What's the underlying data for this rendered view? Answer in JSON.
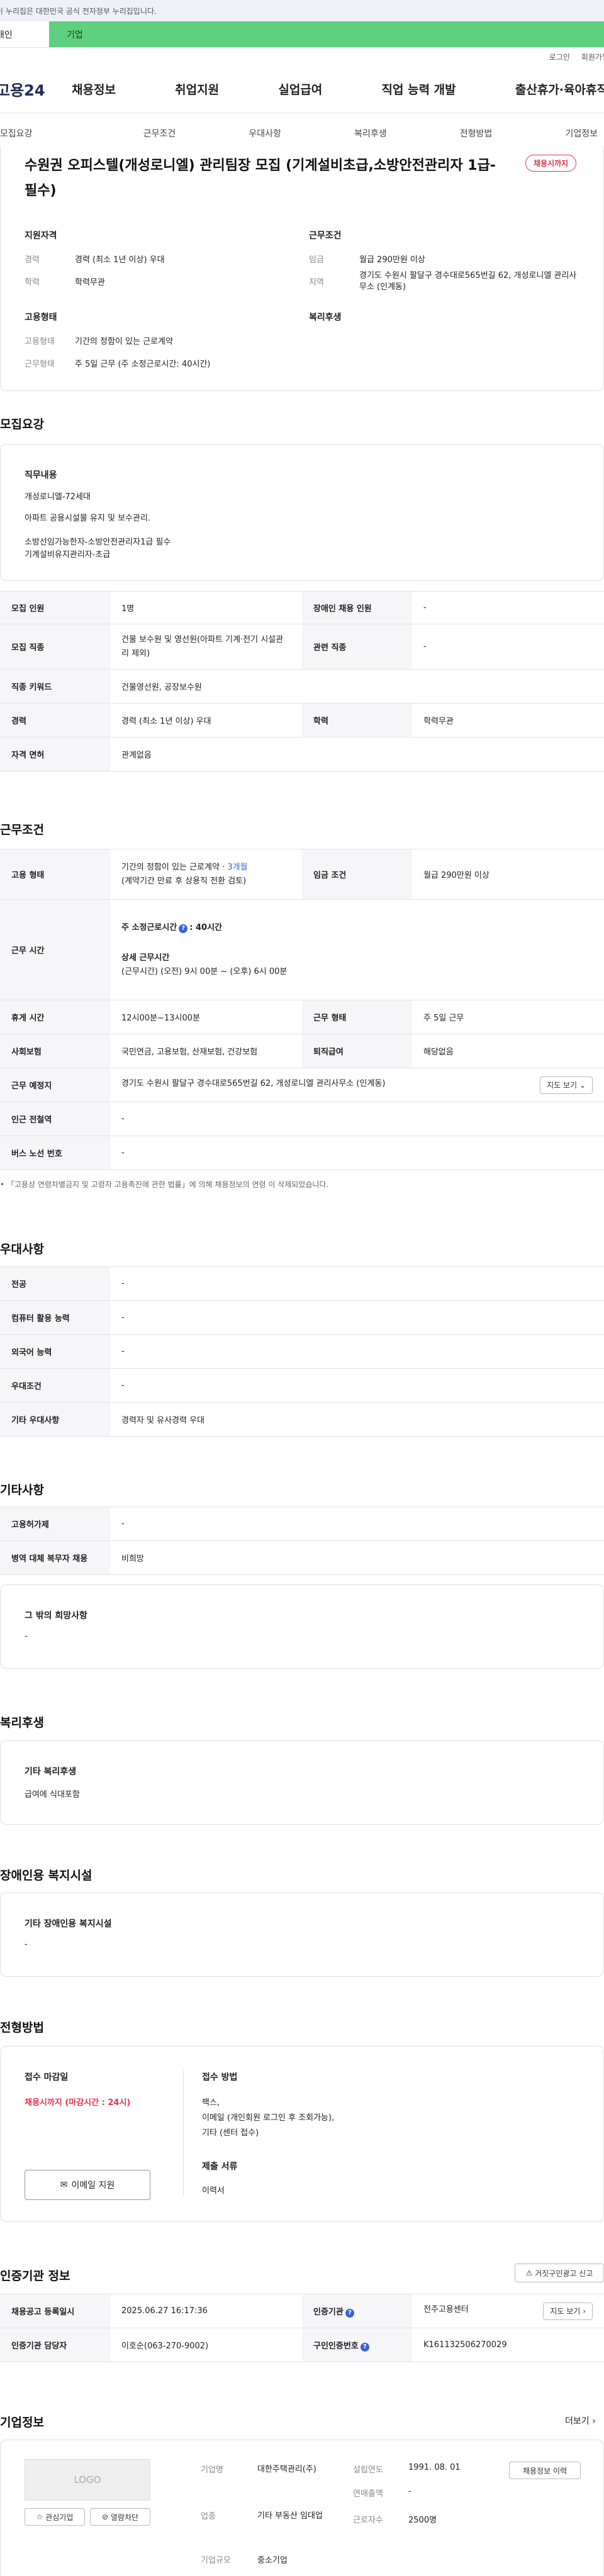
{
  "gov_notice": "이 누리집은 대한민국 공식 전자정부 누리집입니다.",
  "top_tabs": {
    "individual": "개인",
    "enterprise": "기업"
  },
  "util": {
    "login": "로그인",
    "join": "회원가입"
  },
  "logo": "고용24",
  "gnb": [
    "채용정보",
    "취업지원",
    "실업급여",
    "직업 능력 개발",
    "출산휴가·육아휴직"
  ],
  "subnav": [
    "모집요강",
    "근무조건",
    "우대사항",
    "복리후생",
    "전형방법",
    "기업정보"
  ],
  "job": {
    "title": "수원권 오피스텔(개성로니엘) 관리팀장 모집 (기계설비초급,소방안전관리자 1급-필수)",
    "badge": "채용시까지",
    "qual_heading": "지원자격",
    "cond_heading": "근무조건",
    "emp_heading": "고용형태",
    "welfare_heading": "복리후생",
    "qual": [
      {
        "k": "경력",
        "v": "경력 (최소 1년 이상) 우대"
      },
      {
        "k": "학력",
        "v": "학력무관"
      }
    ],
    "cond": [
      {
        "k": "임금",
        "v": "월급 290만원 이상"
      },
      {
        "k": "지역",
        "v": "경기도 수원시 팔달구 경수대로565번길 62, 개성로니엘 관리사무소 (인계동)"
      }
    ],
    "emp": [
      {
        "k": "고용형태",
        "v": "기간의 정함이 있는 근로계약"
      },
      {
        "k": "근무형태",
        "v": "주 5일 근무 (주 소정근로시간: 40시간)"
      }
    ]
  },
  "recruit": {
    "heading": "모집요강",
    "duty_label": "직무내용",
    "duty_lines": [
      "개성로니엘-72세대",
      "아파트 공용시설물 유지 및 보수관리.",
      "소방선임가능한자-소방안전관리자1급 필수",
      "기계설비유지관리자-초급"
    ],
    "rows": [
      {
        "k1": "모집 인원",
        "v1": "1명",
        "k2": "장애인 채용 인원",
        "v2": "-"
      },
      {
        "k1": "모집 직종",
        "v1": "건물 보수원 및 영선원(아파트 기계·전기 시설관리 제외)",
        "k2": "관련 직종",
        "v2": "-"
      },
      {
        "k1": "직종 키워드",
        "v1": "건물영선원, 공장보수원",
        "k2": "",
        "v2": ""
      },
      {
        "k1": "경력",
        "v1": "경력 (최소 1년 이상) 우대",
        "k2": "학력",
        "v2": "학력무관"
      },
      {
        "k1": "자격 면허",
        "v1": "관계없음",
        "k2": "",
        "v2": ""
      }
    ]
  },
  "work": {
    "heading": "근무조건",
    "emp_k": "고용 형태",
    "emp_v1": "기간의 정함이 있는 근로계약 · ",
    "emp_v1_hl": "3개월",
    "emp_v2": "(계약기간 만료 후 상용직 전환 검토)",
    "wage_k": "임금 조건",
    "wage_v": "월급 290만원 이상",
    "time_k": "근무 시간",
    "time_total": "주 소정근로시간",
    "time_total_v": ": 40시간",
    "time_detail_label": "상세 근무시간",
    "time_detail": "(근무시간) (오전) 9시 00분 ~ (오후) 6시 00분",
    "rest_k": "휴게 시간",
    "rest_v": "12시00분~13시00분",
    "type_k": "근무 형태",
    "type_v": "주 5일 근무",
    "ins_k": "사회보험",
    "ins_v": "국민연금, 고용보험, 산재보험, 건강보험",
    "sev_k": "퇴직급여",
    "sev_v": "해당없음",
    "place_k": "근무 예정지",
    "place_v": "경기도 수원시 팔달구 경수대로565번길 62, 개성로니엘 관리사무소 (인계동)",
    "map_btn": "지도 보기",
    "sub_k": "인근 전철역",
    "sub_v": "-",
    "bus_k": "버스 노선 번호",
    "bus_v": "-",
    "note": "「고용상 연령차별금지 및 고령자 고용촉진에 관한 법률」에 의해 채용정보의 연령 이 삭제되었습니다."
  },
  "pref": {
    "heading": "우대사항",
    "rows": [
      {
        "k": "전공",
        "v": "-"
      },
      {
        "k": "컴퓨터 활용 능력",
        "v": "-"
      },
      {
        "k": "외국어 능력",
        "v": "-"
      },
      {
        "k": "우대조건",
        "v": "-"
      },
      {
        "k": "기타 우대사항",
        "v": "경력자 및 유사경력 우대"
      }
    ]
  },
  "etc": {
    "heading": "기타사항",
    "rows": [
      {
        "k": "고용허가제",
        "v": "-"
      },
      {
        "k": "병역 대체 복무자 채용",
        "v": "비희망"
      }
    ],
    "other_label": "그 밖의 희망사항",
    "other_v": "-"
  },
  "welfare": {
    "heading": "복리후생",
    "label": "기타 복리후생",
    "value": "급여에 식대포함"
  },
  "disab": {
    "heading": "장애인용 복지시설",
    "label": "기타 장애인용 복지시설",
    "value": "-"
  },
  "select": {
    "heading": "전형방법",
    "deadline_label": "접수 마감일",
    "deadline_v": "채용시까지 (마감시간 : 24시)",
    "method_label": "접수 방법",
    "method_lines": [
      "팩스,",
      "이메일 (개인회원 로그인 후 조회가능),",
      "기타 (센터 접수)"
    ],
    "docs_label": "제출 서류",
    "docs_v": "이력서",
    "email_btn": "이메일 지원"
  },
  "cert": {
    "heading": "인증기관 정보",
    "report_btn": "거짓구인광고 신고",
    "reg_k": "채용공고 등록일시",
    "reg_v": "2025.06.27 16:17:36",
    "org_k": "인증기관",
    "org_v": "전주고용센터",
    "map_btn": "지도 보기",
    "mgr_k": "인증기관 담당자",
    "mgr_v": "이호순(063-270-9002)",
    "id_k": "구인인증번호",
    "id_v": "K161132506270029"
  },
  "company": {
    "heading": "기업정보",
    "more": "더보기",
    "logo": "LOGO",
    "fav": "관심기업",
    "block": "열람차단",
    "name_k": "기업명",
    "name_v": "대한주택관리(주)",
    "year_k": "설립연도",
    "year_v": "1991. 08. 01",
    "history_btn": "채용정보 이력",
    "rev_k": "연매출액",
    "rev_v": "-",
    "ind_k": "업종",
    "ind_v": "기타 부동산 임대업",
    "emp_k": "근로자수",
    "emp_v": "2500명",
    "size_k": "기업규모",
    "size_v": "중소기업"
  }
}
